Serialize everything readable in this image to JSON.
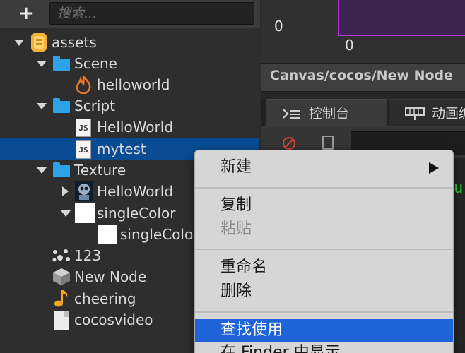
{
  "assets": {
    "toolbar": {
      "add_label": "+",
      "search_placeholder": "搜索..."
    },
    "tree": {
      "root": "assets",
      "scene": "Scene",
      "helloworld_scene": "helloworld",
      "script": "Script",
      "helloworld_js": "HelloWorld",
      "mytest": "mytest",
      "texture": "Texture",
      "helloworld_texture": "HelloWorld",
      "singlecolor": "singleColor",
      "singlecolor_sub": "singleColor",
      "item_123": "123",
      "new_node": "New Node",
      "cheering": "cheering",
      "cocosvideo": "cocosvideo"
    },
    "icons": {
      "assets": "database-icon",
      "folder": "folder-icon",
      "scene": "flame-icon",
      "script": "js-icon",
      "texture": "sprite-icon",
      "prefab": "cube-icon",
      "audio": "music-note-icon",
      "video": "document-icon",
      "particle": "particle-icon"
    },
    "colors": {
      "selection": "#094c94",
      "folder": "#2ea2e8",
      "background": "#2e2e2e"
    }
  },
  "scene": {
    "axis_y_zero": "0",
    "axis_x_zero": "0",
    "node_path": "Canvas/cocos/New Node",
    "canvas_color": "#b437d4"
  },
  "console": {
    "tabs": [
      {
        "label": "控制台",
        "icon": "console-icon"
      },
      {
        "label": "动画编",
        "icon": "timeline-icon"
      }
    ],
    "tool_icons": [
      "clear-icon",
      "file-icon"
    ],
    "partial_output": "ur"
  },
  "context_menu": {
    "new": "新建",
    "copy": "复制",
    "paste": "粘贴",
    "rename": "重命名",
    "delete": "删除",
    "find_usage": "查找使用",
    "show_in_finder": "在 Finder 中显示",
    "colors": {
      "highlight": "#1e64d8",
      "background": "#d6d6d6"
    }
  }
}
